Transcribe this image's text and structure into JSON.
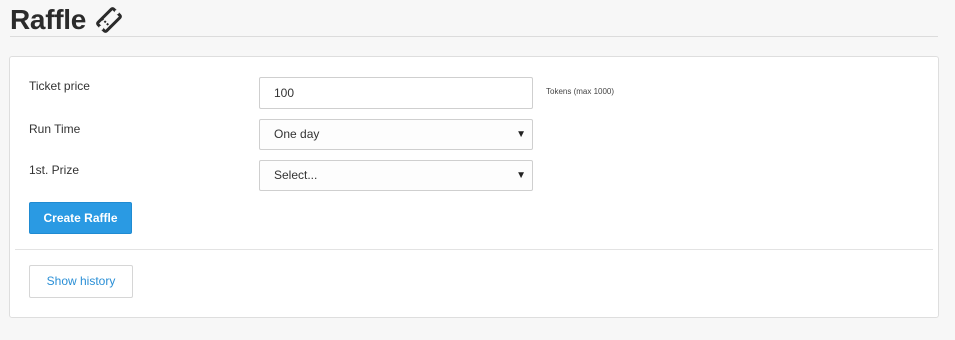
{
  "page": {
    "title": "Raffle",
    "title_icon": "ticket-icon"
  },
  "form": {
    "ticket_price": {
      "label": "Ticket price",
      "value": "100",
      "hint": "Tokens (max 1000)"
    },
    "run_time": {
      "label": "Run Time",
      "selected": "One day",
      "caret_icon": "caret-down-icon"
    },
    "first_prize": {
      "label": "1st. Prize",
      "selected": "Select...",
      "caret_icon": "caret-down-icon"
    },
    "create_button": "Create Raffle"
  },
  "history": {
    "button": "Show history"
  },
  "colors": {
    "primary": "#2a9ae3",
    "link": "#2a8fd6",
    "background": "#f7f7f7"
  }
}
